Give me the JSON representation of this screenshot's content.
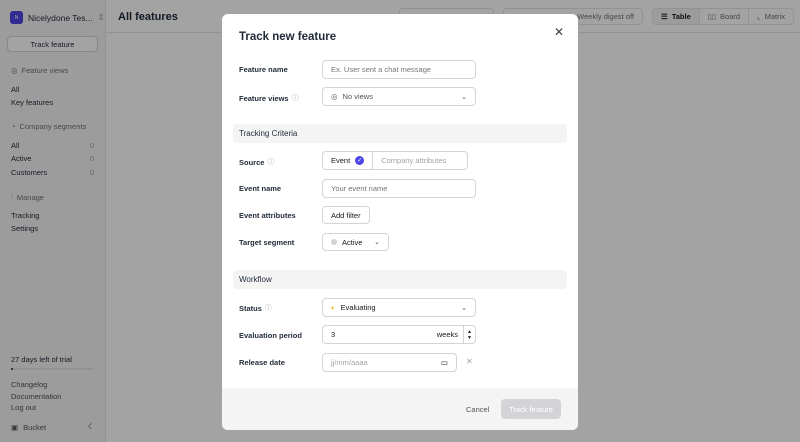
{
  "sidebar": {
    "workspace": "Nicelydone Tes...",
    "avatar": "N",
    "track_button": "Track feature",
    "feature_views": {
      "title": "Feature views",
      "items": [
        "All",
        "Key features"
      ]
    },
    "segments": {
      "title": "Company segments",
      "items": [
        {
          "label": "All",
          "count": "0"
        },
        {
          "label": "Active",
          "count": "0"
        },
        {
          "label": "Customers",
          "count": "0"
        }
      ]
    },
    "manage": {
      "title": "Manage",
      "items": [
        "Tracking",
        "Settings"
      ]
    },
    "trial": "27 days left of trial",
    "trial_progress": 0.03,
    "links": [
      "Changelog",
      "Documentation",
      "Log out"
    ],
    "brand": "Bucket"
  },
  "header": {
    "title": "All features",
    "digest": "Weekly digest off",
    "views": [
      "Table",
      "Board",
      "Matrix"
    ]
  },
  "modal": {
    "title": "Track new feature",
    "feature_name": {
      "label": "Feature name",
      "placeholder": "Ex. User sent a chat message"
    },
    "feature_views": {
      "label": "Feature views",
      "value": "No views"
    },
    "section1": "Tracking Criteria",
    "source": {
      "label": "Source",
      "options": [
        "Event",
        "Company attributes"
      ],
      "selected": "Event"
    },
    "event_name": {
      "label": "Event name",
      "placeholder": "Your event name"
    },
    "event_attributes": {
      "label": "Event attributes",
      "button": "Add filter"
    },
    "target_segment": {
      "label": "Target segment",
      "value": "Active"
    },
    "section2": "Workflow",
    "status": {
      "label": "Status",
      "value": "Evaluating"
    },
    "evaluation_period": {
      "label": "Evaluation period",
      "value": "3",
      "unit": "weeks"
    },
    "release_date": {
      "label": "Release date",
      "placeholder": "jj/mm/aaaa"
    },
    "cancel": "Cancel",
    "submit": "Track feature"
  },
  "colors": {
    "accent": "#4f46e5",
    "evaluating": "#f5b800"
  }
}
